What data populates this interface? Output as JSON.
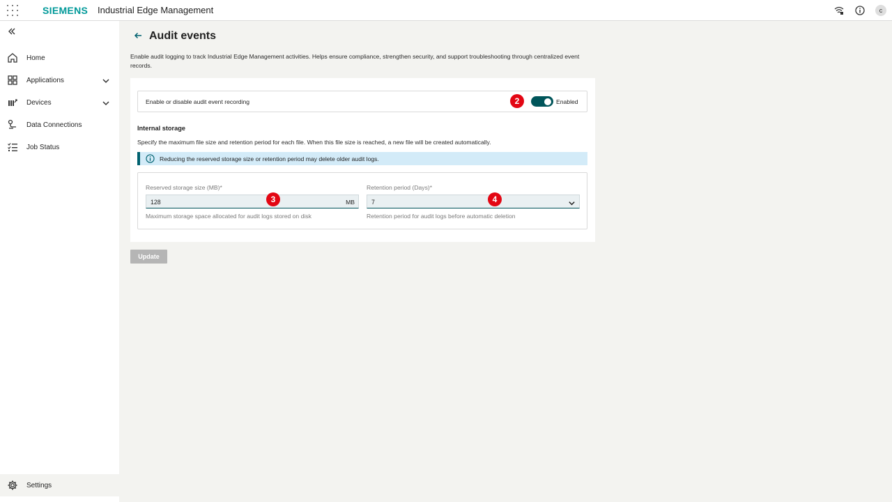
{
  "header": {
    "brand": "SIEMENS",
    "app_title": "Industrial Edge Management",
    "avatar_initial": "c",
    "icons": [
      "apps-grid-icon",
      "network-icon",
      "info-icon"
    ]
  },
  "sidebar": {
    "items": [
      {
        "label": "Home",
        "icon": "home-icon"
      },
      {
        "label": "Applications",
        "icon": "applications-icon",
        "expandable": true
      },
      {
        "label": "Devices",
        "icon": "devices-icon",
        "expandable": true
      },
      {
        "label": "Data Connections",
        "icon": "data-connections-icon"
      },
      {
        "label": "Job Status",
        "icon": "job-status-icon"
      }
    ],
    "settings_label": "Settings"
  },
  "page": {
    "title": "Audit events",
    "description": "Enable audit logging to track Industrial Edge Management activities. Helps ensure compliance, strengthen security, and support troubleshooting through centralized event records."
  },
  "recording": {
    "label": "Enable or disable audit event recording",
    "state_label": "Enabled",
    "enabled": true
  },
  "storage": {
    "title": "Internal storage",
    "description": "Specify the maximum file size and retention period for each file. When this file size is reached, a new file will be created automatically.",
    "alert": "Reducing the reserved storage size or retention period may delete older audit logs.",
    "size_field": {
      "label": "Reserved storage size (MB)*",
      "value": "128",
      "unit": "MB",
      "help": "Maximum storage space allocated for audit logs stored on disk"
    },
    "retention_field": {
      "label": "Retention period (Days)*",
      "value": "7",
      "help": "Retention period for audit logs before automatic deletion"
    }
  },
  "update_label": "Update",
  "markers": {
    "toggle": "2",
    "size": "3",
    "retention": "4"
  },
  "colors": {
    "brand": "#009999",
    "toggle_on": "#00555a",
    "alert_bg": "#d3ebf8",
    "alert_border": "#00616f",
    "marker": "#e30613",
    "button_disabled": "#b5b5b5"
  }
}
